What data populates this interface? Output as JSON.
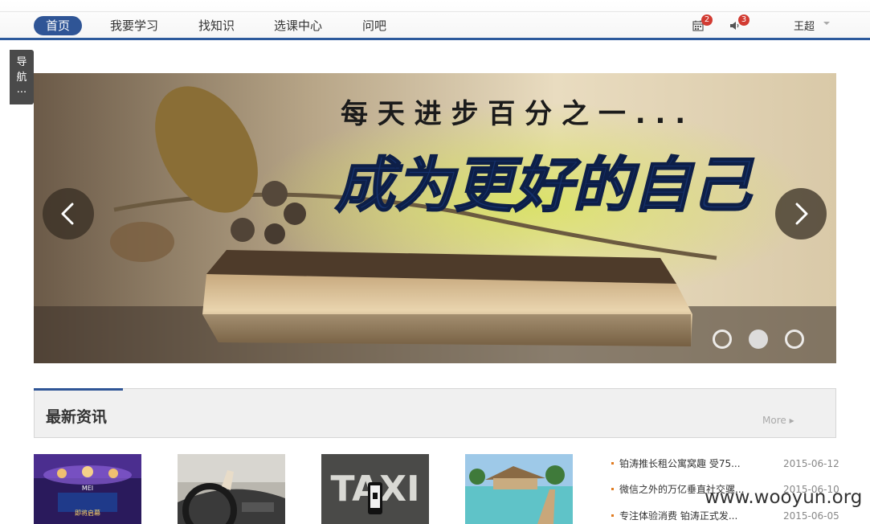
{
  "nav": {
    "items": [
      "首页",
      "我要学习",
      "找知识",
      "选课中心",
      "问吧"
    ],
    "calendar_badge": "2",
    "sound_badge": "3",
    "user_name": "王超",
    "user_caret": "▾"
  },
  "side_nav": {
    "line1": "导",
    "line2": "航",
    "line3": "..."
  },
  "banner": {
    "tagline": "每 天 进 步 百 分 之 一 . . .",
    "headline": "成为更好的自己",
    "prev_icon": "chevron-left-icon",
    "next_icon": "chevron-right-icon",
    "slide_count": 3,
    "active_slide": 2
  },
  "news": {
    "title": "最新资讯",
    "more_label": "More ▸",
    "thumb_texts": {
      "stage_logo": "MEI",
      "stage_caption": "即将启幕",
      "taxi": "TAXI"
    },
    "items": [
      {
        "title": "铂涛推长租公寓窝趣 受75...",
        "date": "2015-06-12"
      },
      {
        "title": "微信之外的万亿垂直社交骡...",
        "date": "2015-06-10"
      },
      {
        "title": "专注体验消费  铂涛正式发...",
        "date": "2015-06-05"
      }
    ]
  },
  "watermark": "www.wooyun.org",
  "colors": {
    "accent": "#2f5596",
    "badge": "#d23b32",
    "bullet": "#e07a1f"
  }
}
